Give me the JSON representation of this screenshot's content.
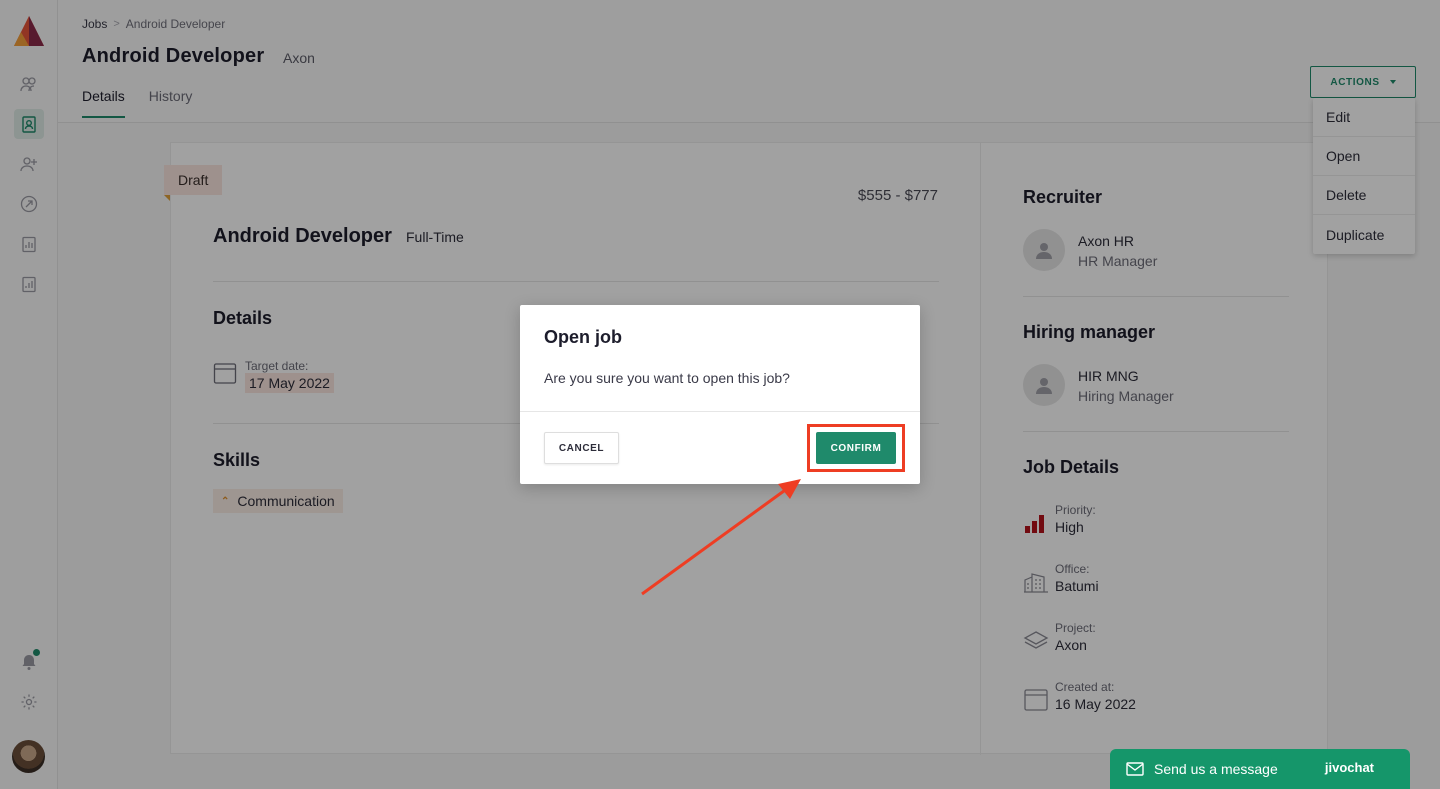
{
  "breadcrumb": {
    "root": "Jobs",
    "separator": ">",
    "current": "Android Developer"
  },
  "header": {
    "title": "Android Developer",
    "subtitle": "Axon"
  },
  "tabs": [
    {
      "label": "Details"
    },
    {
      "label": "History"
    }
  ],
  "actions": {
    "label": "ACTIONS",
    "menu": [
      "Edit",
      "Open",
      "Delete",
      "Duplicate"
    ]
  },
  "job": {
    "status": "Draft",
    "salary": "$555 - $777",
    "title": "Android Developer",
    "type": "Full-Time",
    "details_title": "Details",
    "target_label": "Target date:",
    "target_value": "17 May 2022",
    "skills_title": "Skills",
    "skills": [
      "Communication"
    ]
  },
  "recruiter": {
    "title": "Recruiter",
    "name": "Axon HR",
    "role": "HR Manager"
  },
  "hiring_manager": {
    "title": "Hiring manager",
    "name": "HIR MNG",
    "role": "Hiring Manager"
  },
  "job_details": {
    "title": "Job Details",
    "priority_label": "Priority:",
    "priority_value": "High",
    "office_label": "Office:",
    "office_value": "Batumi",
    "project_label": "Project:",
    "project_value": "Axon",
    "created_label": "Created at:",
    "created_value": "16 May 2022"
  },
  "modal": {
    "title": "Open job",
    "message": "Are you sure you want to open this job?",
    "cancel": "CANCEL",
    "confirm": "CONFIRM"
  },
  "chat": {
    "label": "Send us a message",
    "brand": "jivochat"
  },
  "colors": {
    "accent": "#1f8a6b",
    "highlight": "#ee3d23",
    "chat": "#15966a",
    "priority": "#b5121b"
  }
}
